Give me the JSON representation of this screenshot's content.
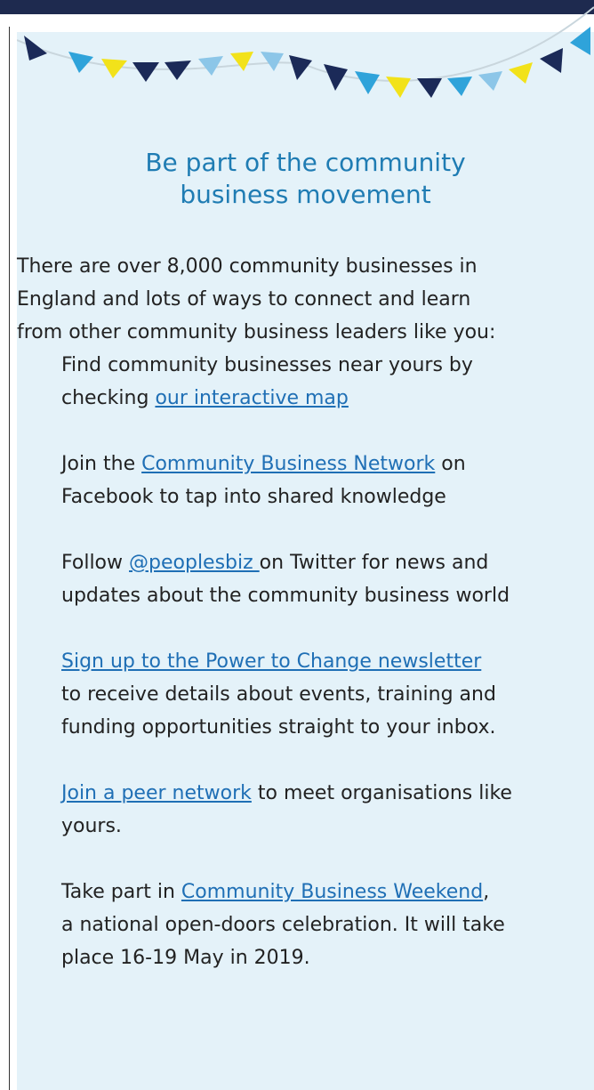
{
  "heading": {
    "line1": "Be part of the community",
    "line2": "business movement"
  },
  "intro": {
    "line1": "There are over 8,000 community businesses in",
    "line2": "England and lots of ways to connect and learn",
    "line3": "from other community business leaders like you:"
  },
  "items": {
    "map": {
      "line1": "Find community businesses near yours by",
      "pre": "checking ",
      "link": "our interactive map"
    },
    "facebook": {
      "pre": "Join the ",
      "link": "Community Business Network",
      "post": " on",
      "line2": "Facebook to tap into shared knowledge"
    },
    "twitter": {
      "pre": "Follow ",
      "link": "@peoplesbiz ",
      "post": "on Twitter for news and",
      "line2": "updates about the community business world"
    },
    "newsletter": {
      "link": "Sign up to the Power to Change newsletter",
      "line2": "to receive details about events, training and",
      "line3": "funding opportunities straight to your inbox."
    },
    "peer": {
      "link": "Join a peer network",
      "post": " to meet organisations like",
      "line2": "yours."
    },
    "weekend": {
      "pre": "Take part in ",
      "link": "Community Business Weekend",
      "post": ",",
      "line2": "a national open-doors celebration. It will take",
      "line3": "place 16-19 May in 2019."
    }
  },
  "colors": {
    "top_rule": "#1e2a4f",
    "panel_background": "#e4f2f9",
    "heading": "#1f7cb3",
    "link": "#1f6fb5",
    "bunting_navy": "#1b2a58",
    "bunting_yellow": "#f2e21a",
    "bunting_blue": "#2fa3da",
    "bunting_light_blue": "#8cc6e8"
  }
}
